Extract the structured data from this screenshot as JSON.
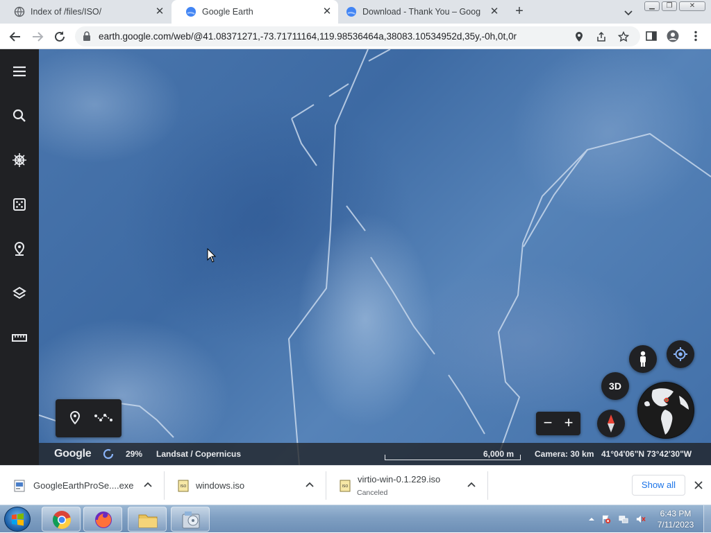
{
  "browser": {
    "tabs": [
      {
        "title": "Index of /files/ISO/",
        "active": false
      },
      {
        "title": "Google Earth",
        "active": true
      },
      {
        "title": "Download - Thank You – Google",
        "active": false
      }
    ],
    "url": "earth.google.com/web/@41.08371271,-73.71711164,119.98536464a,38083.10534952d,35y,-0h,0t,0r"
  },
  "earth": {
    "status": {
      "logo": "Google",
      "loading_percent": "29%",
      "imagery_credit": "Landsat / Copernicus",
      "scale_label": "6,000 m",
      "camera": "Camera: 30 km",
      "coordinates": "41°04'06\"N 73°42'30\"W"
    },
    "controls": {
      "three_d_label": "3D",
      "zoom_out": "−",
      "zoom_in": "+"
    }
  },
  "downloads": {
    "items": [
      {
        "name": "GoogleEarthProSe....exe",
        "status": ""
      },
      {
        "name": "windows.iso",
        "status": ""
      },
      {
        "name": "virtio-win-0.1.229.iso",
        "status": "Canceled"
      }
    ],
    "show_all_label": "Show all"
  },
  "taskbar": {
    "time": "6:43 PM",
    "date": "7/11/2023"
  },
  "colors": {
    "sidebar_bg": "#202124",
    "map_blue": "#4a76ad",
    "link_blue": "#1a73e8"
  }
}
